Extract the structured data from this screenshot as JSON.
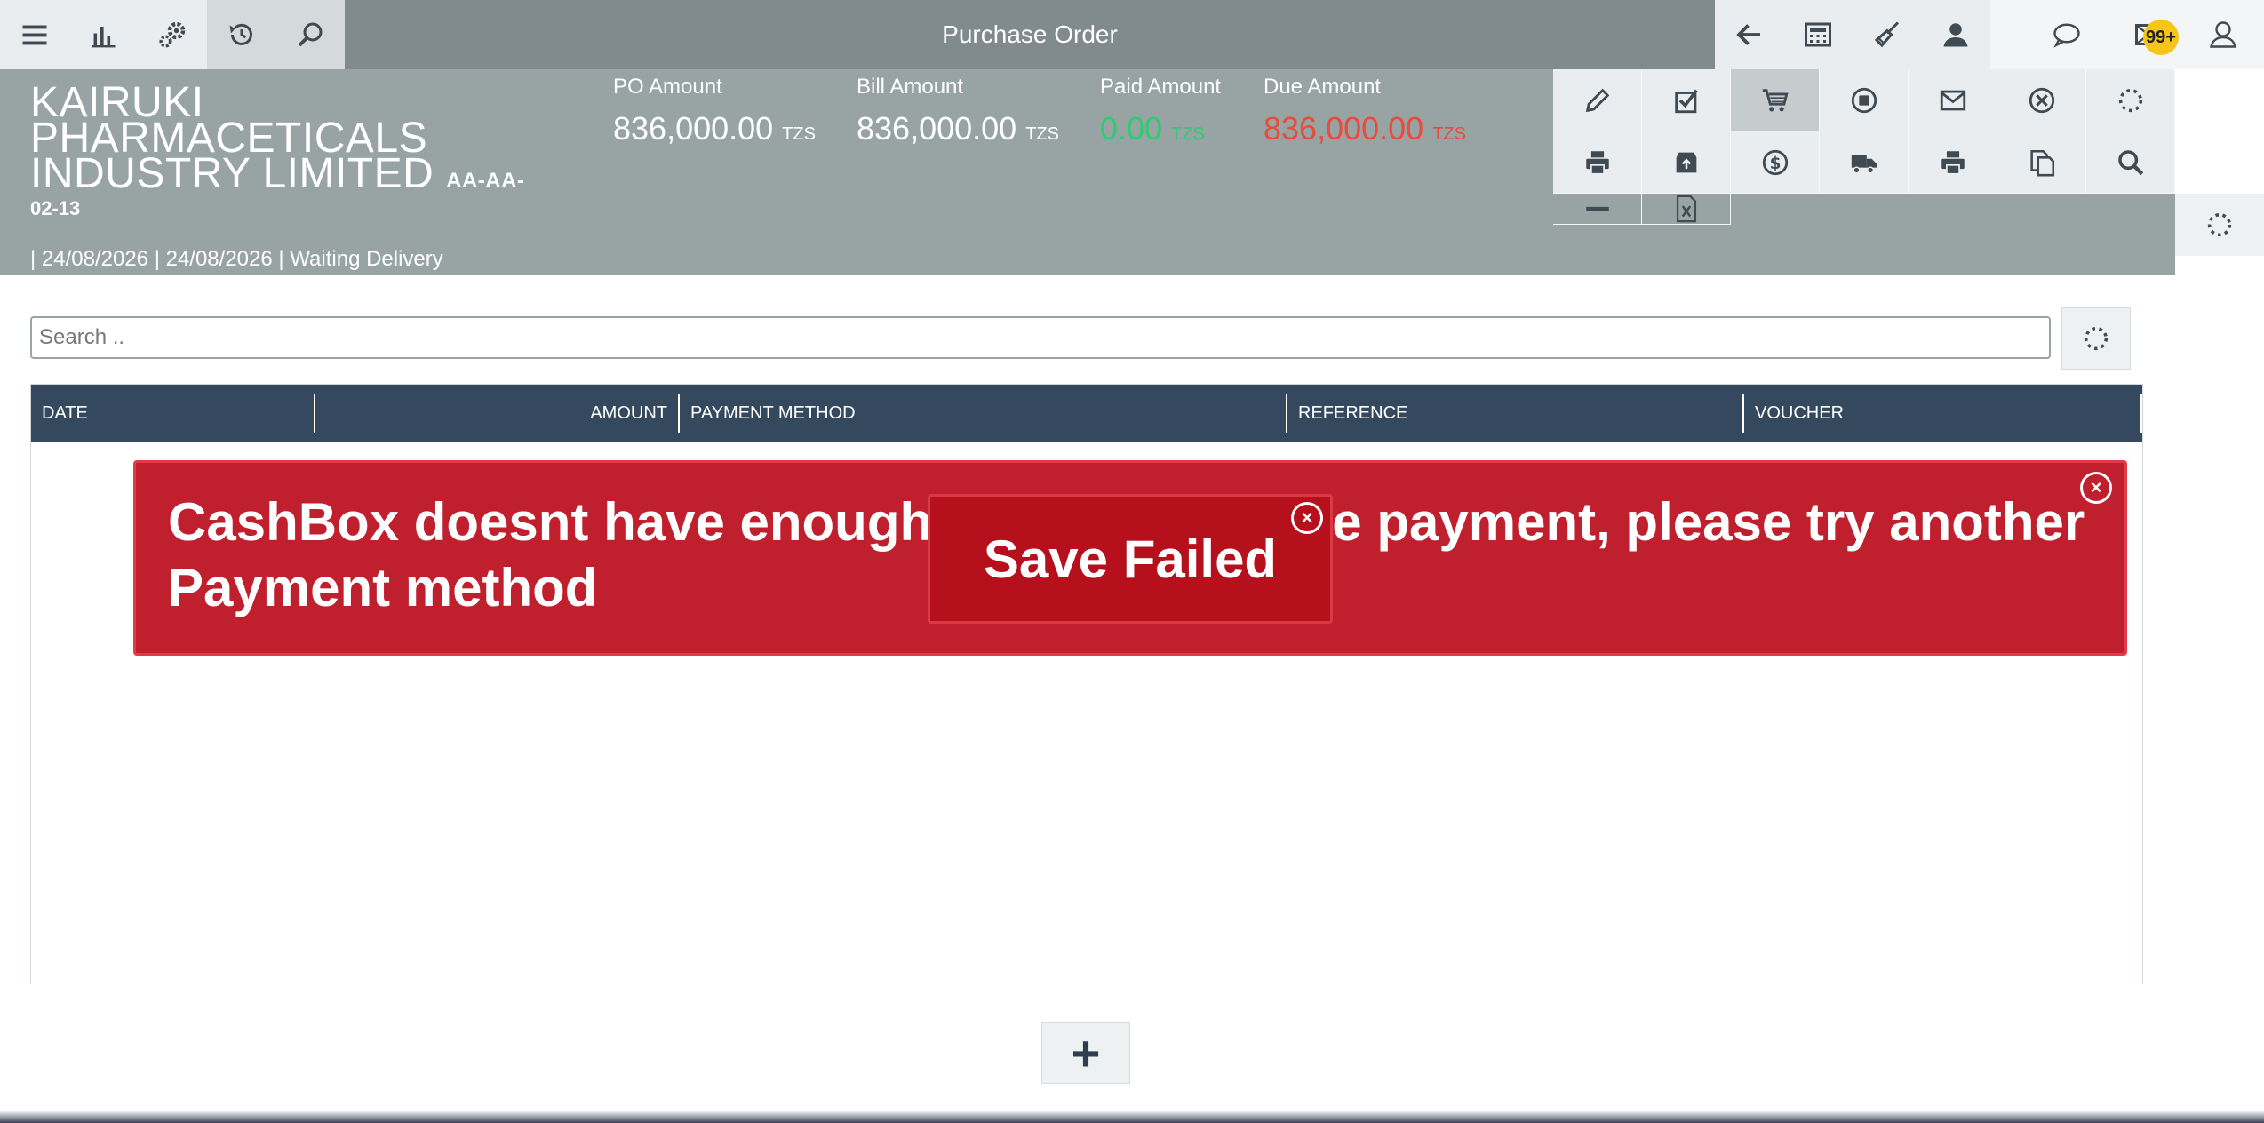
{
  "topbar": {
    "title": "Purchase Order",
    "left_icons": [
      "menu-icon",
      "bar-chart-icon",
      "settings-gear-icon",
      "history-icon",
      "search-icon"
    ],
    "right_icons": [
      "arrow-left-icon",
      "calculator-icon",
      "broom-icon",
      "user-icon"
    ],
    "far_icons": [
      "chat-icon",
      "mail-icon",
      "user-outline-icon"
    ],
    "badge": "99+"
  },
  "header": {
    "company": "KAIRUKI PHARMACETICALS INDUSTRY LIMITED",
    "code_part1": "AA-AA-",
    "code_part2": "02-13",
    "meta": "| 24/08/2026 | 24/08/2026 | Waiting Delivery",
    "amounts": [
      {
        "label": "PO Amount",
        "value": "836,000.00",
        "currency": "TZS"
      },
      {
        "label": "Bill Amount",
        "value": "836,000.00",
        "currency": "TZS"
      },
      {
        "label": "Paid Amount",
        "value": "0.00",
        "currency": "TZS"
      },
      {
        "label": "Due Amount",
        "value": "836,000.00",
        "currency": "TZS"
      }
    ]
  },
  "actions": [
    "pencil-icon",
    "checkbox-icon",
    "cart-icon",
    "stop-icon",
    "envelope-icon",
    "cancel-circle-icon",
    "spinner-icon",
    "printer-icon",
    "archive-icon",
    "dollar-icon",
    "truck-icon",
    "printer-icon",
    "copy-icon",
    "magnifier-icon",
    "minus-icon",
    "excel-icon"
  ],
  "search": {
    "placeholder": "Search .."
  },
  "table": {
    "columns": [
      "DATE",
      "AMOUNT",
      "PAYMENT METHOD",
      "REFERENCE",
      "VOUCHER"
    ]
  },
  "alerts": {
    "error_message": "CashBox doesnt have enough balance to make payment, please try another Payment method",
    "save_failed": "Save Failed"
  },
  "add_button": "+",
  "colors": {
    "paid": "#2ecc71",
    "due": "#e74c3c",
    "alert": "#c0202e",
    "table_header": "#34495e"
  }
}
